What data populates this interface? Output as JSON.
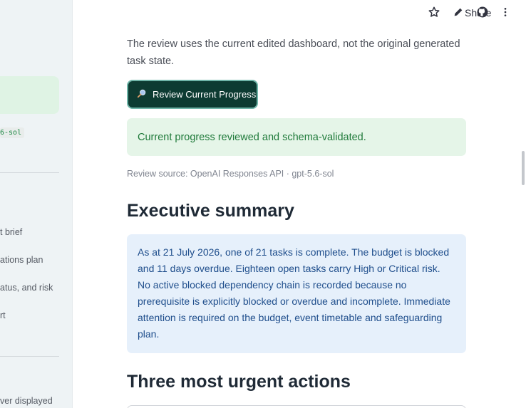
{
  "sidebar": {
    "model_code": "6-sol",
    "links": [
      "t brief",
      "ations plan",
      "atus, and risk",
      "rt"
    ],
    "footer_text": "ver displayed"
  },
  "header": {
    "share_label": "Share",
    "icons": [
      "star-icon",
      "pencil-icon",
      "github-icon",
      "more-vertical-icon"
    ]
  },
  "main": {
    "intro_text": "The review uses the current edited dashboard, not the original generated task state.",
    "review_button": {
      "icon": "magnifier-icon",
      "label": "Review Current Progress"
    },
    "success_message": "Current progress reviewed and schema-validated.",
    "review_source": "Review source: OpenAI Responses API · gpt-5.6-sol",
    "executive_heading": "Executive summary",
    "executive_summary": "As at 21 July 2026, one of 21 tasks is complete. The budget is blocked and 11 days overdue. Eighteen open tasks carry High or Critical risk. No active blocked dependency chain is recorded because no prerequisite is explicitly blocked or overdue and incomplete. Immediate attention is required on the budget, event timetable and safeguarding plan.",
    "urgent_heading": "Three most urgent actions"
  },
  "colors": {
    "button_bg": "#0d3b32",
    "success_bg": "#e5f5e8",
    "info_bg": "#e6f0fb",
    "sidebar_bg": "#eef3f5"
  }
}
